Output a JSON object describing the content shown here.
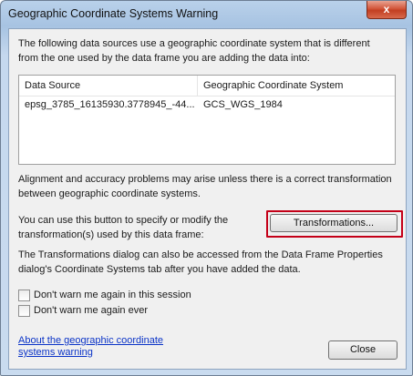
{
  "window": {
    "title": "Geographic Coordinate Systems Warning",
    "close_glyph": "x"
  },
  "intro_text": "The following data sources use a geographic coordinate system that is different from the one used by the data frame you are adding the data into:",
  "table": {
    "columns": [
      "Data Source",
      "Geographic Coordinate System"
    ],
    "rows": [
      [
        "epsg_3785_16135930.3778945_-44...",
        "GCS_WGS_1984"
      ]
    ]
  },
  "alignment_text": "Alignment and accuracy problems may arise unless there is a correct transformation between geographic coordinate systems.",
  "button_hint_text": "You can use this button to specify or modify the transformation(s) used by this data frame:",
  "transformations_button": "Transformations...",
  "alt_access_text": "The Transformations dialog can also be accessed from the Data Frame Properties dialog's Coordinate Systems tab after you have added the data.",
  "checkboxes": [
    {
      "label": "Don't warn me again in this session",
      "checked": false
    },
    {
      "label": "Don't warn me again ever",
      "checked": false
    }
  ],
  "help_link": "About the geographic coordinate systems warning",
  "close_button": "Close",
  "colors": {
    "highlight_border": "#c40018",
    "link": "#0b34c7"
  }
}
